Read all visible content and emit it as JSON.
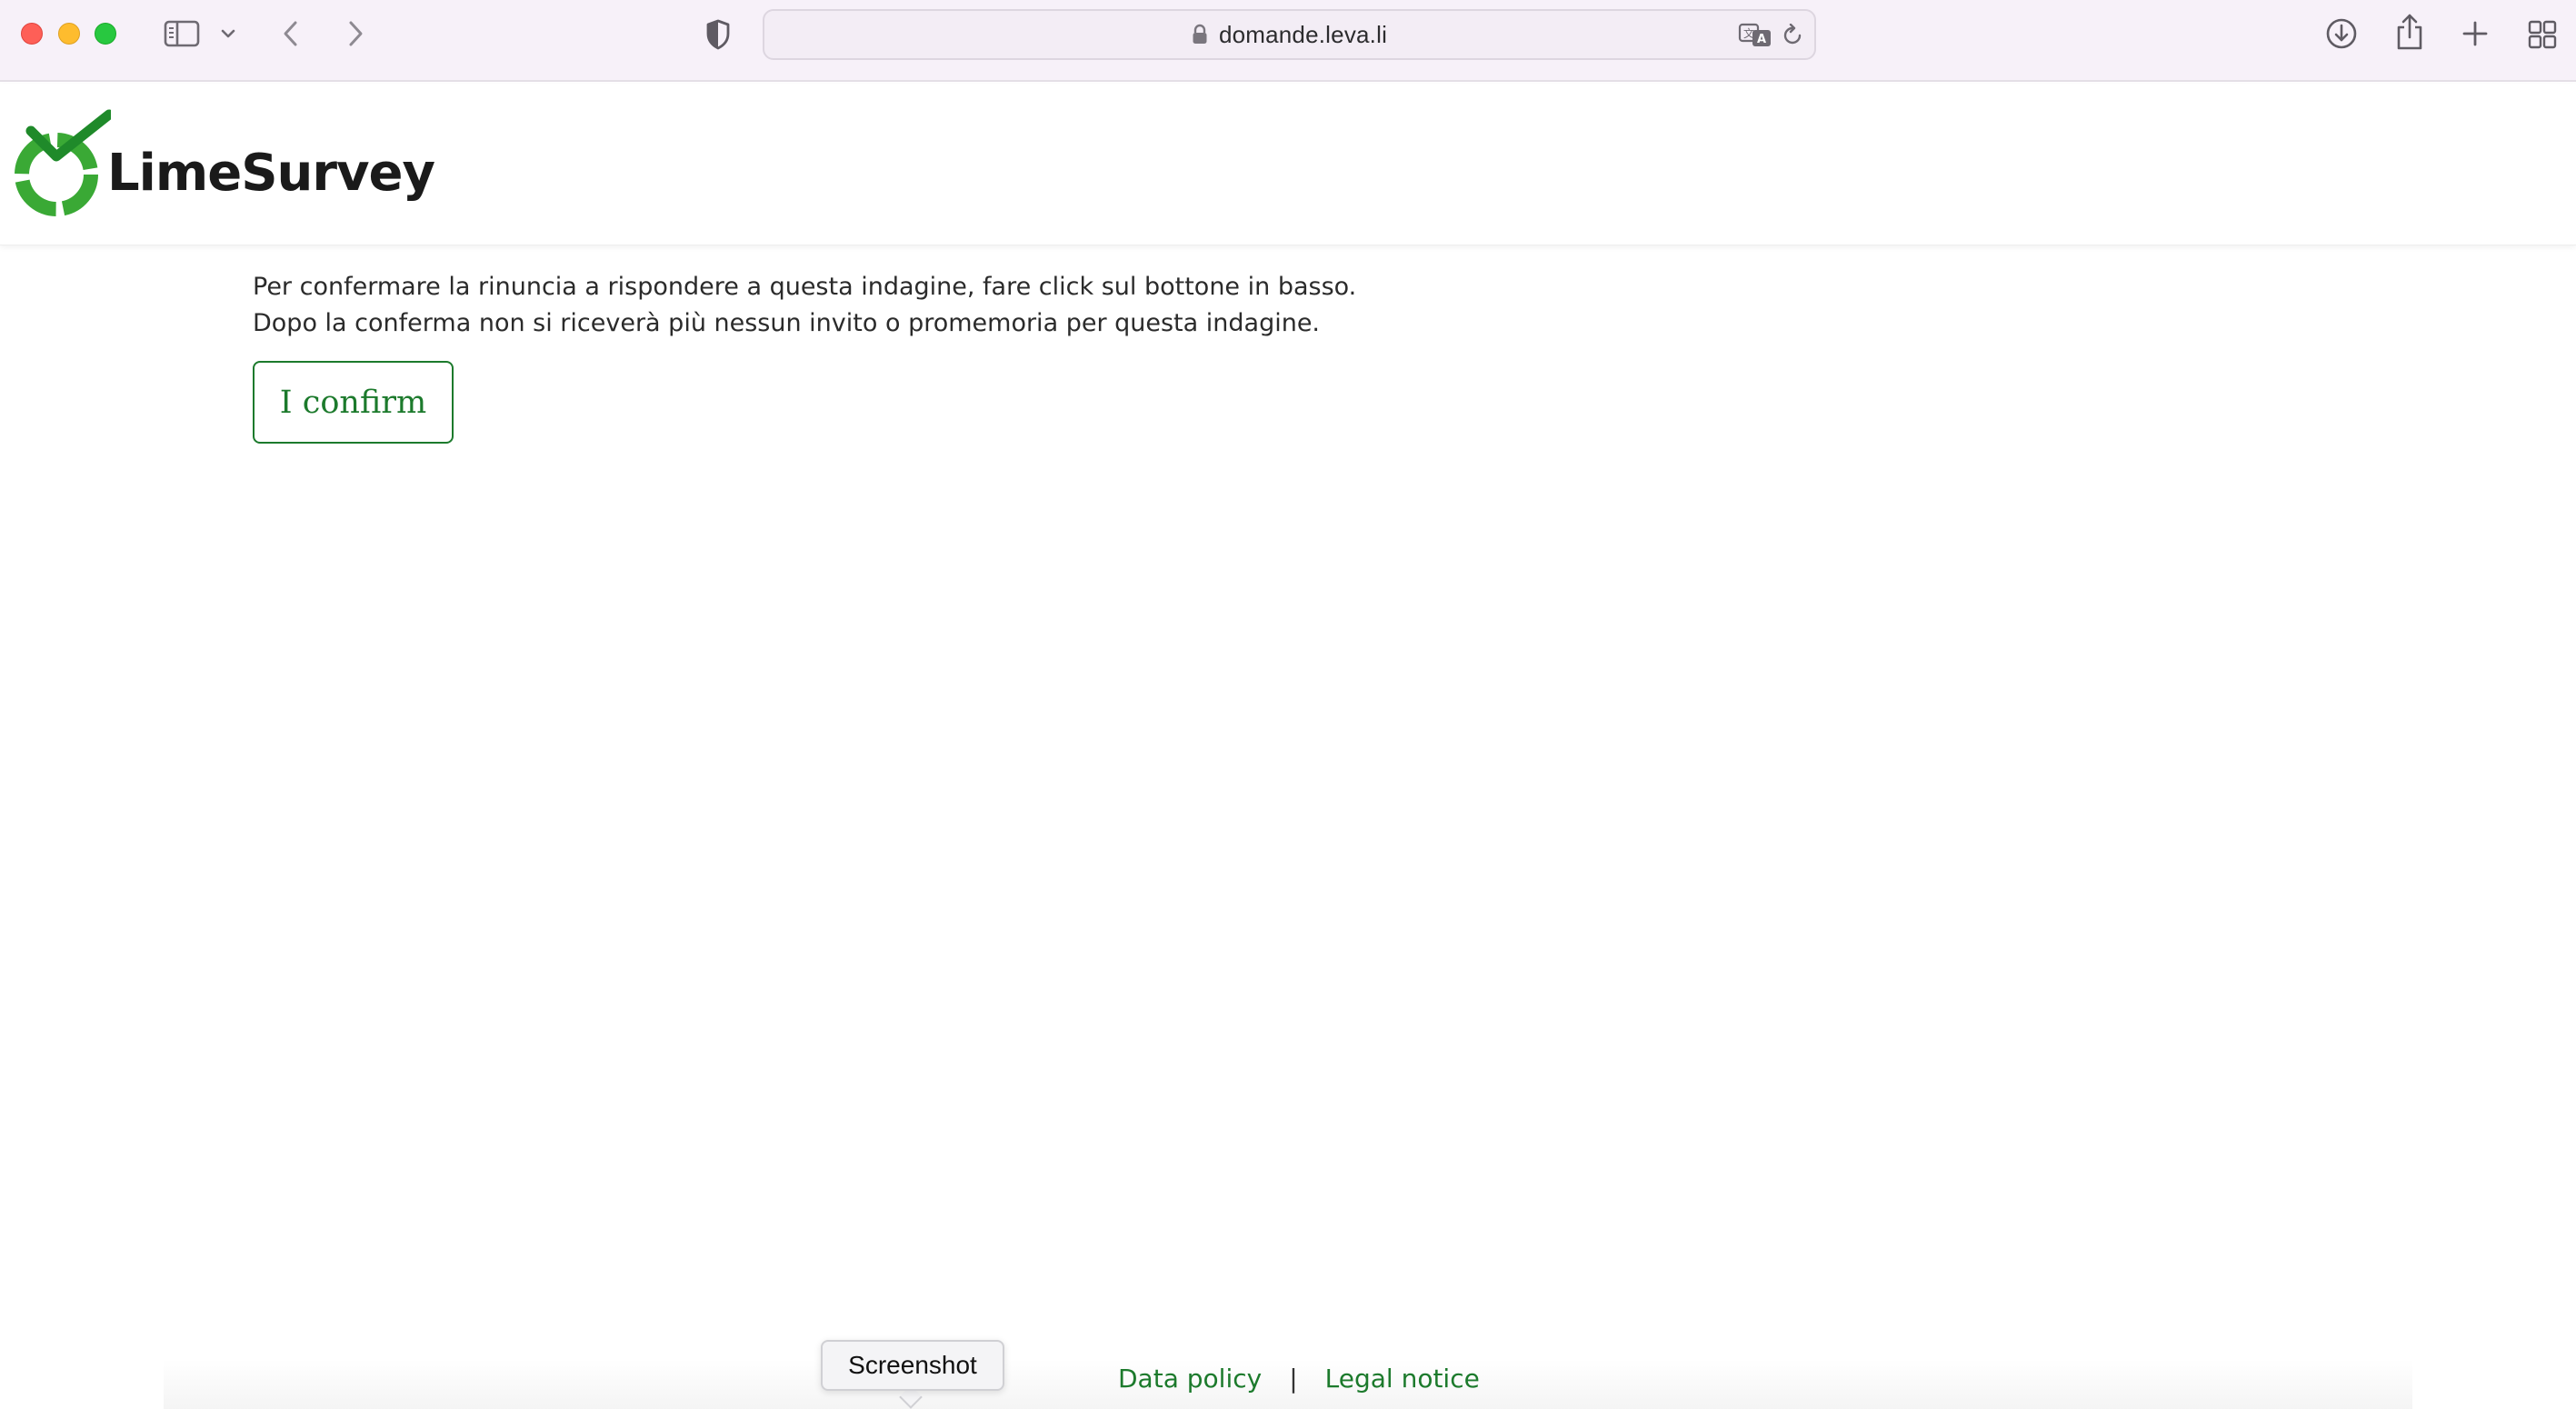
{
  "browser": {
    "url": "domande.leva.li",
    "icons": {
      "sidebar": "sidebar-icon",
      "chevron": "chevron-down-icon",
      "back": "back-arrow-icon",
      "forward": "forward-arrow-icon",
      "privacy": "shield-icon",
      "lock": "lock-icon",
      "translate": "translate-icon",
      "reload": "reload-icon",
      "downloads": "download-icon",
      "share": "share-icon",
      "new_tab": "plus-icon",
      "tab_overview": "grid-icon"
    }
  },
  "site": {
    "logo_text": "LimeSurvey",
    "brand_color": "#1c7a2c"
  },
  "main": {
    "message_line1": "Per confermare la rinuncia a rispondere a questa indagine, fare click sul bottone in basso.",
    "message_line2": "Dopo la conferma non si riceverà più nessun invito o promemoria per questa indagine.",
    "confirm_label": "I confirm"
  },
  "footer": {
    "data_policy": "Data policy",
    "separator": "|",
    "legal_notice": "Legal notice"
  },
  "tooltip": {
    "label": "Screenshot"
  }
}
